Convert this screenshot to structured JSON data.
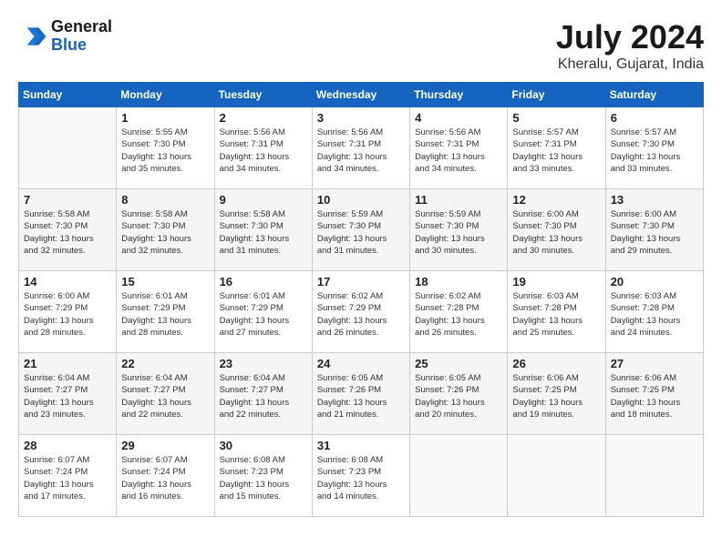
{
  "header": {
    "logo_line1": "General",
    "logo_line2": "Blue",
    "month_year": "July 2024",
    "location": "Kheralu, Gujarat, India"
  },
  "days_of_week": [
    "Sunday",
    "Monday",
    "Tuesday",
    "Wednesday",
    "Thursday",
    "Friday",
    "Saturday"
  ],
  "weeks": [
    [
      {
        "num": "",
        "info": ""
      },
      {
        "num": "1",
        "info": "Sunrise: 5:55 AM\nSunset: 7:30 PM\nDaylight: 13 hours\nand 35 minutes."
      },
      {
        "num": "2",
        "info": "Sunrise: 5:56 AM\nSunset: 7:31 PM\nDaylight: 13 hours\nand 34 minutes."
      },
      {
        "num": "3",
        "info": "Sunrise: 5:56 AM\nSunset: 7:31 PM\nDaylight: 13 hours\nand 34 minutes."
      },
      {
        "num": "4",
        "info": "Sunrise: 5:56 AM\nSunset: 7:31 PM\nDaylight: 13 hours\nand 34 minutes."
      },
      {
        "num": "5",
        "info": "Sunrise: 5:57 AM\nSunset: 7:31 PM\nDaylight: 13 hours\nand 33 minutes."
      },
      {
        "num": "6",
        "info": "Sunrise: 5:57 AM\nSunset: 7:30 PM\nDaylight: 13 hours\nand 33 minutes."
      }
    ],
    [
      {
        "num": "7",
        "info": "Sunrise: 5:58 AM\nSunset: 7:30 PM\nDaylight: 13 hours\nand 32 minutes."
      },
      {
        "num": "8",
        "info": "Sunrise: 5:58 AM\nSunset: 7:30 PM\nDaylight: 13 hours\nand 32 minutes."
      },
      {
        "num": "9",
        "info": "Sunrise: 5:58 AM\nSunset: 7:30 PM\nDaylight: 13 hours\nand 31 minutes."
      },
      {
        "num": "10",
        "info": "Sunrise: 5:59 AM\nSunset: 7:30 PM\nDaylight: 13 hours\nand 31 minutes."
      },
      {
        "num": "11",
        "info": "Sunrise: 5:59 AM\nSunset: 7:30 PM\nDaylight: 13 hours\nand 30 minutes."
      },
      {
        "num": "12",
        "info": "Sunrise: 6:00 AM\nSunset: 7:30 PM\nDaylight: 13 hours\nand 30 minutes."
      },
      {
        "num": "13",
        "info": "Sunrise: 6:00 AM\nSunset: 7:30 PM\nDaylight: 13 hours\nand 29 minutes."
      }
    ],
    [
      {
        "num": "14",
        "info": "Sunrise: 6:00 AM\nSunset: 7:29 PM\nDaylight: 13 hours\nand 28 minutes."
      },
      {
        "num": "15",
        "info": "Sunrise: 6:01 AM\nSunset: 7:29 PM\nDaylight: 13 hours\nand 28 minutes."
      },
      {
        "num": "16",
        "info": "Sunrise: 6:01 AM\nSunset: 7:29 PM\nDaylight: 13 hours\nand 27 minutes."
      },
      {
        "num": "17",
        "info": "Sunrise: 6:02 AM\nSunset: 7:29 PM\nDaylight: 13 hours\nand 26 minutes."
      },
      {
        "num": "18",
        "info": "Sunrise: 6:02 AM\nSunset: 7:28 PM\nDaylight: 13 hours\nand 26 minutes."
      },
      {
        "num": "19",
        "info": "Sunrise: 6:03 AM\nSunset: 7:28 PM\nDaylight: 13 hours\nand 25 minutes."
      },
      {
        "num": "20",
        "info": "Sunrise: 6:03 AM\nSunset: 7:28 PM\nDaylight: 13 hours\nand 24 minutes."
      }
    ],
    [
      {
        "num": "21",
        "info": "Sunrise: 6:04 AM\nSunset: 7:27 PM\nDaylight: 13 hours\nand 23 minutes."
      },
      {
        "num": "22",
        "info": "Sunrise: 6:04 AM\nSunset: 7:27 PM\nDaylight: 13 hours\nand 22 minutes."
      },
      {
        "num": "23",
        "info": "Sunrise: 6:04 AM\nSunset: 7:27 PM\nDaylight: 13 hours\nand 22 minutes."
      },
      {
        "num": "24",
        "info": "Sunrise: 6:05 AM\nSunset: 7:26 PM\nDaylight: 13 hours\nand 21 minutes."
      },
      {
        "num": "25",
        "info": "Sunrise: 6:05 AM\nSunset: 7:26 PM\nDaylight: 13 hours\nand 20 minutes."
      },
      {
        "num": "26",
        "info": "Sunrise: 6:06 AM\nSunset: 7:25 PM\nDaylight: 13 hours\nand 19 minutes."
      },
      {
        "num": "27",
        "info": "Sunrise: 6:06 AM\nSunset: 7:25 PM\nDaylight: 13 hours\nand 18 minutes."
      }
    ],
    [
      {
        "num": "28",
        "info": "Sunrise: 6:07 AM\nSunset: 7:24 PM\nDaylight: 13 hours\nand 17 minutes."
      },
      {
        "num": "29",
        "info": "Sunrise: 6:07 AM\nSunset: 7:24 PM\nDaylight: 13 hours\nand 16 minutes."
      },
      {
        "num": "30",
        "info": "Sunrise: 6:08 AM\nSunset: 7:23 PM\nDaylight: 13 hours\nand 15 minutes."
      },
      {
        "num": "31",
        "info": "Sunrise: 6:08 AM\nSunset: 7:23 PM\nDaylight: 13 hours\nand 14 minutes."
      },
      {
        "num": "",
        "info": ""
      },
      {
        "num": "",
        "info": ""
      },
      {
        "num": "",
        "info": ""
      }
    ]
  ]
}
